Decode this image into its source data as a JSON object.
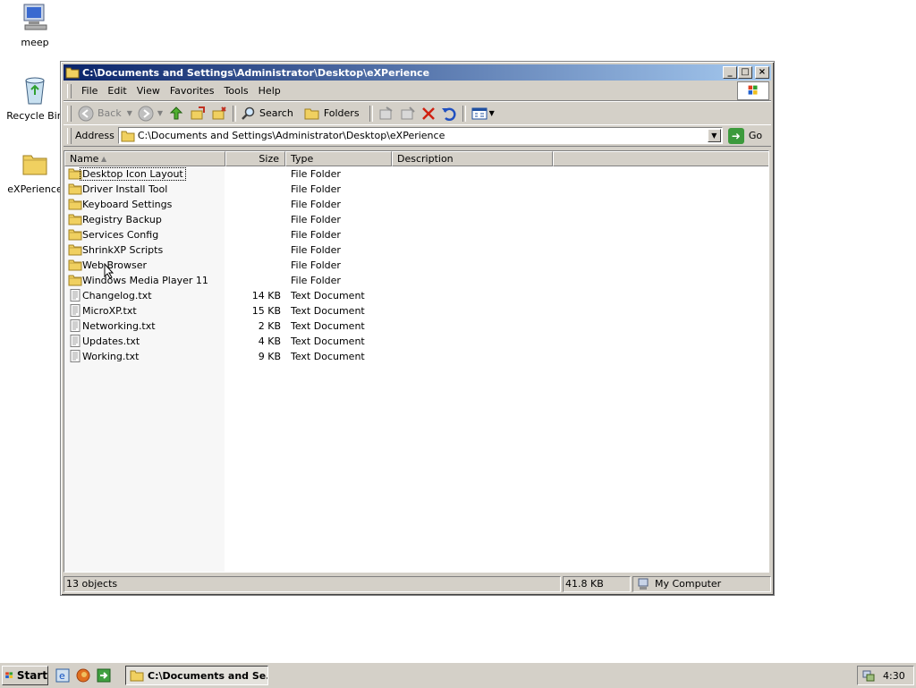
{
  "desktop": {
    "icons": [
      {
        "label": "meep"
      },
      {
        "label": "Recycle Bin"
      },
      {
        "label": "eXPerience"
      }
    ]
  },
  "window": {
    "title": "C:\\Documents and Settings\\Administrator\\Desktop\\eXPerience",
    "buttons": {
      "minimize": "_",
      "maximize": "□",
      "close": "×"
    }
  },
  "menu": {
    "items": [
      {
        "label": "File"
      },
      {
        "label": "Edit"
      },
      {
        "label": "View"
      },
      {
        "label": "Favorites"
      },
      {
        "label": "Tools"
      },
      {
        "label": "Help"
      }
    ]
  },
  "toolbar": {
    "back_label": "Back",
    "search_label": "Search",
    "folders_label": "Folders"
  },
  "address": {
    "label": "Address",
    "value": "C:\\Documents and Settings\\Administrator\\Desktop\\eXPerience",
    "go_label": "Go"
  },
  "columns": {
    "name": "Name",
    "size": "Size",
    "type": "Type",
    "description": "Description"
  },
  "files": [
    {
      "name": "Desktop Icon Layout",
      "size": "",
      "type": "File Folder",
      "kind": "folder"
    },
    {
      "name": "Driver Install Tool",
      "size": "",
      "type": "File Folder",
      "kind": "folder"
    },
    {
      "name": "Keyboard Settings",
      "size": "",
      "type": "File Folder",
      "kind": "folder"
    },
    {
      "name": "Registry Backup",
      "size": "",
      "type": "File Folder",
      "kind": "folder"
    },
    {
      "name": "Services Config",
      "size": "",
      "type": "File Folder",
      "kind": "folder"
    },
    {
      "name": "ShrinkXP Scripts",
      "size": "",
      "type": "File Folder",
      "kind": "folder"
    },
    {
      "name": "Web Browser",
      "size": "",
      "type": "File Folder",
      "kind": "folder"
    },
    {
      "name": "Windows Media Player 11",
      "size": "",
      "type": "File Folder",
      "kind": "folder"
    },
    {
      "name": "Changelog.txt",
      "size": "14 KB",
      "type": "Text Document",
      "kind": "text"
    },
    {
      "name": "MicroXP.txt",
      "size": "15 KB",
      "type": "Text Document",
      "kind": "text"
    },
    {
      "name": "Networking.txt",
      "size": "2 KB",
      "type": "Text Document",
      "kind": "text"
    },
    {
      "name": "Updates.txt",
      "size": "4 KB",
      "type": "Text Document",
      "kind": "text"
    },
    {
      "name": "Working.txt",
      "size": "9 KB",
      "type": "Text Document",
      "kind": "text"
    }
  ],
  "status": {
    "objects": "13 objects",
    "size": "41.8 KB",
    "zone": "My Computer"
  },
  "taskbar": {
    "start_label": "Start",
    "task_label": "C:\\Documents and Se...",
    "clock": "4:30"
  },
  "colors": {
    "title_start": "#0a246a",
    "title_end": "#a6caf0",
    "chrome": "#d4d0c8",
    "folder": "#f0d060"
  }
}
